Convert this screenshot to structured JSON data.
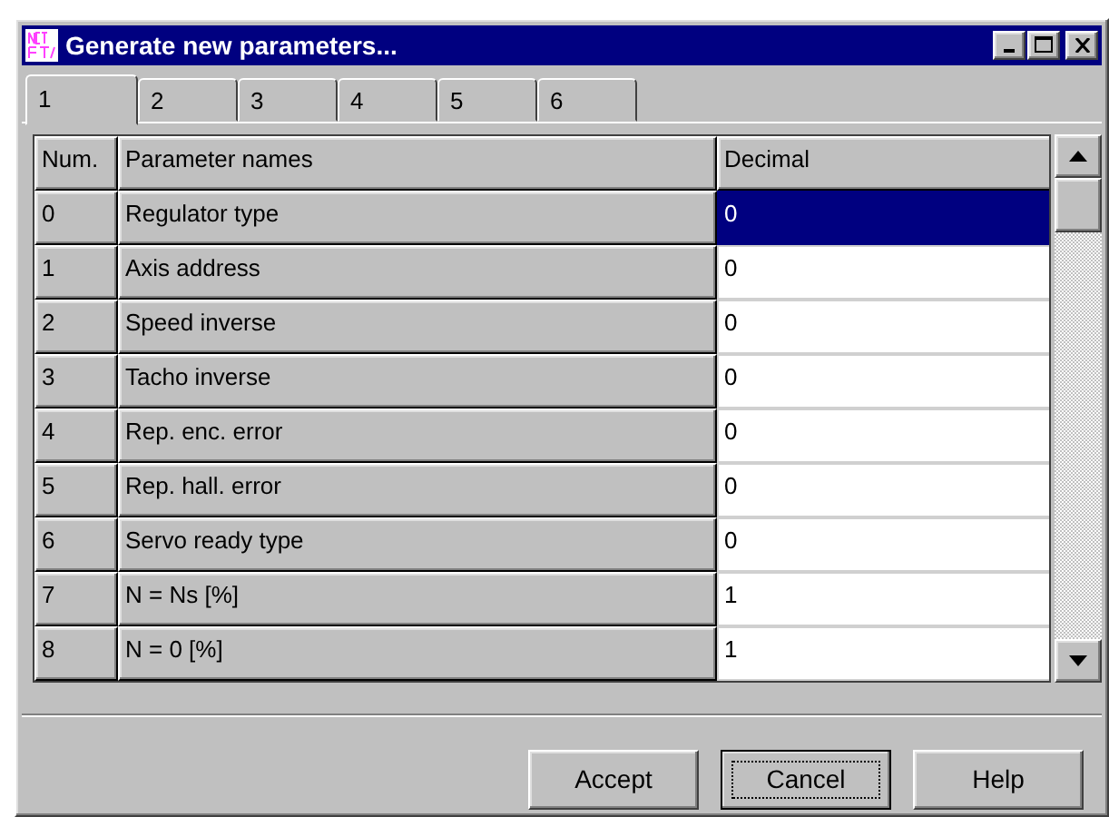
{
  "window": {
    "title": "Generate new parameters..."
  },
  "tabs": [
    {
      "label": "1",
      "selected": true
    },
    {
      "label": "2",
      "selected": false
    },
    {
      "label": "3",
      "selected": false
    },
    {
      "label": "4",
      "selected": false
    },
    {
      "label": "5",
      "selected": false
    },
    {
      "label": "6",
      "selected": false
    }
  ],
  "table": {
    "columns": [
      "Num.",
      "Parameter names",
      "Decimal"
    ],
    "rows": [
      {
        "num": "0",
        "name": "Regulator type",
        "value": "0",
        "selected": true
      },
      {
        "num": "1",
        "name": "Axis address",
        "value": "0",
        "selected": false
      },
      {
        "num": "2",
        "name": "Speed inverse",
        "value": "0",
        "selected": false
      },
      {
        "num": "3",
        "name": "Tacho inverse",
        "value": "0",
        "selected": false
      },
      {
        "num": "4",
        "name": "Rep. enc. error",
        "value": "0",
        "selected": false
      },
      {
        "num": "5",
        "name": "Rep. hall. error",
        "value": "0",
        "selected": false
      },
      {
        "num": "6",
        "name": "Servo ready type",
        "value": "0",
        "selected": false
      },
      {
        "num": "7",
        "name": "N = Ns [%]",
        "value": "1",
        "selected": false
      },
      {
        "num": "8",
        "name": "N = 0 [%]",
        "value": "1",
        "selected": false
      }
    ]
  },
  "buttons": [
    {
      "label": "Accept",
      "focused": false
    },
    {
      "label": "Cancel",
      "focused": true
    },
    {
      "label": "Help",
      "focused": false
    }
  ]
}
